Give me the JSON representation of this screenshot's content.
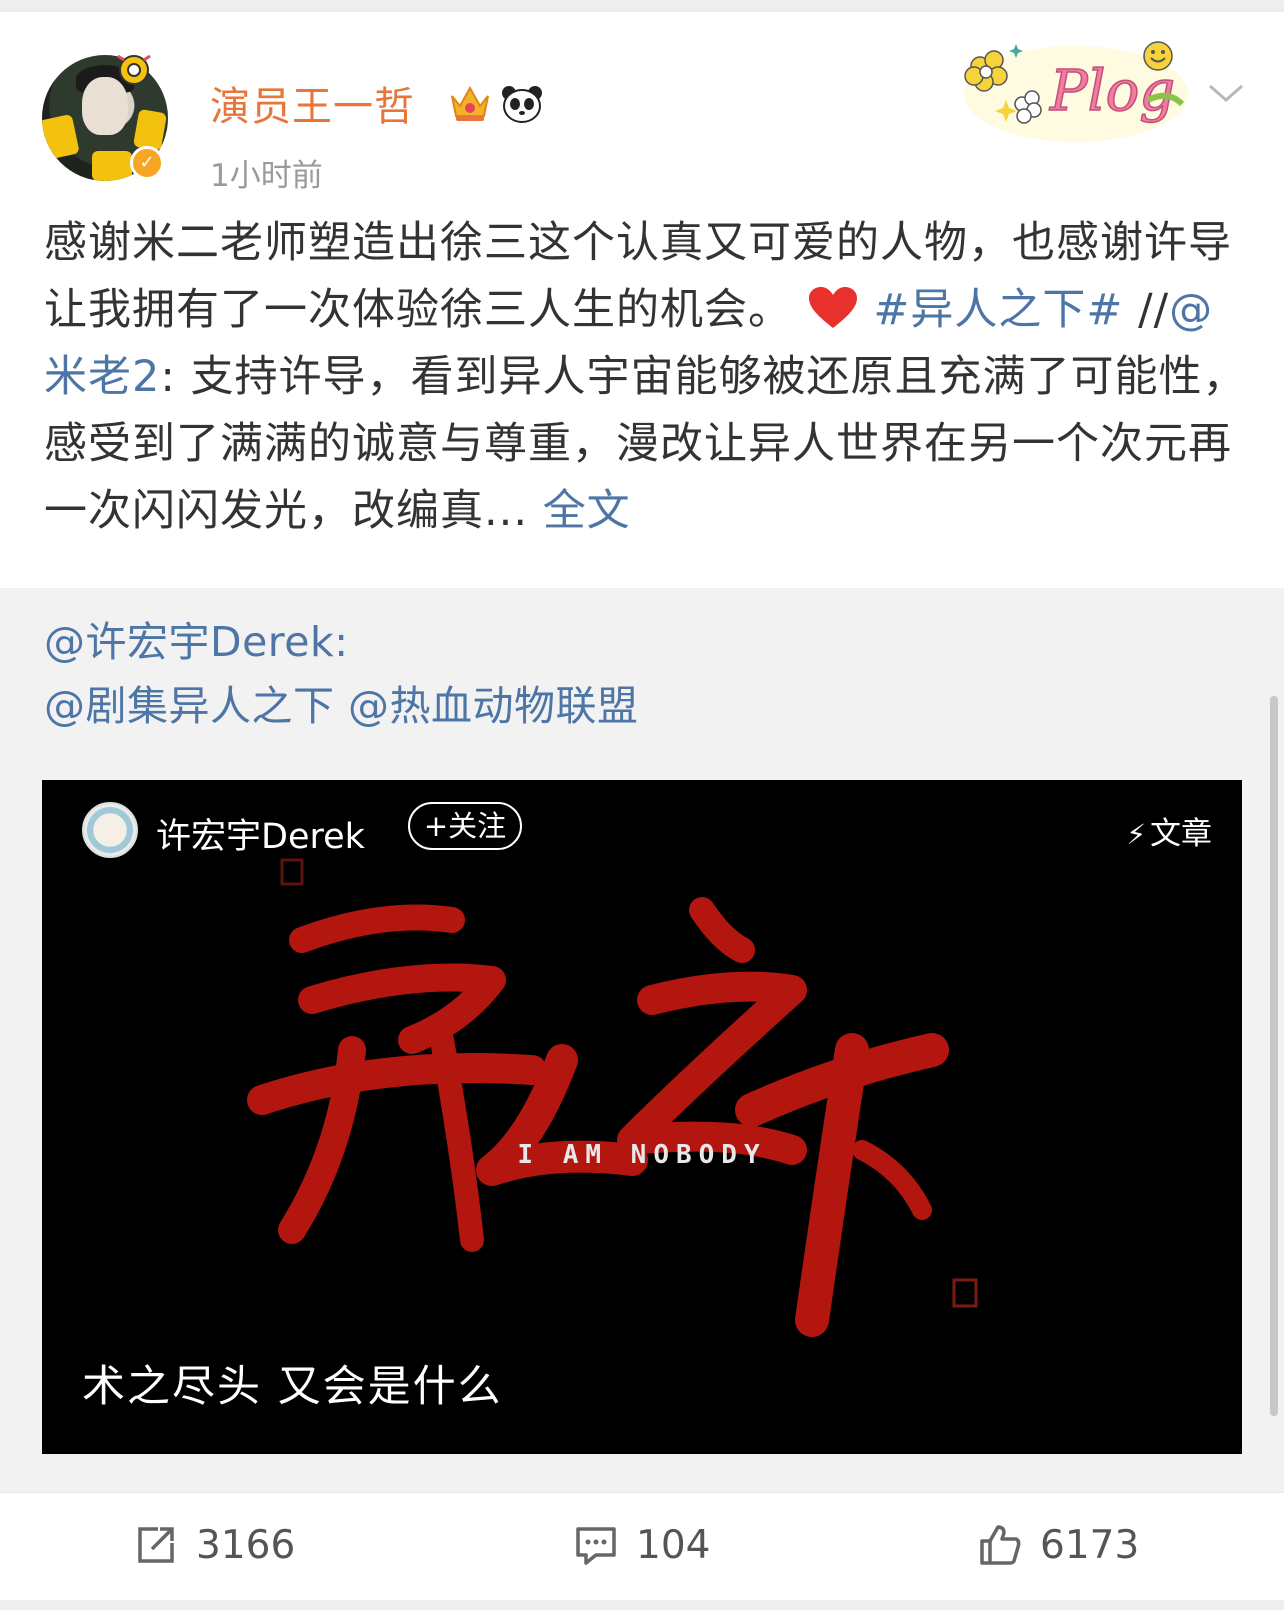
{
  "post": {
    "author": "演员王一哲",
    "time": "1小时前",
    "text_plain_1": "感谢米二老师塑造出徐三这个认真又可爱的人物，也感谢许导让我拥有了一次体验徐三人生的机会。",
    "hashtag": "#异人之下#",
    "repost_sep": " //",
    "mention_mi": "@米老2",
    "text_plain_2": ": 支持许导，看到异人宇宙能够被还原且充满了可能性，感受到了满满的诚意与尊重，漫改让异人世界在另一个次元再一次闪闪发光，改编真... ",
    "full_text_link": "全文"
  },
  "repost": {
    "origin_author": "@许宏宇Derek:",
    "mention_1": "@剧集异人之下",
    "mention_2": "@热血动物联盟",
    "video": {
      "author": "许宏宇Derek",
      "follow_label": "+关注",
      "tag_label": "文章",
      "title_en": "I AM NOBODY",
      "caption": "术之尽头 又会是什么"
    }
  },
  "actions": {
    "share_count": "3166",
    "comment_count": "104",
    "like_count": "6173"
  },
  "colors": {
    "username": "#e8763b",
    "link": "#4d75a6",
    "verified": "#f6a623",
    "calligraphy": "#b3150f"
  },
  "icons": [
    "crown-icon",
    "panda-icon",
    "chevron-down-icon",
    "heart-icon",
    "lightning-icon",
    "share-icon",
    "comment-icon",
    "like-icon"
  ]
}
